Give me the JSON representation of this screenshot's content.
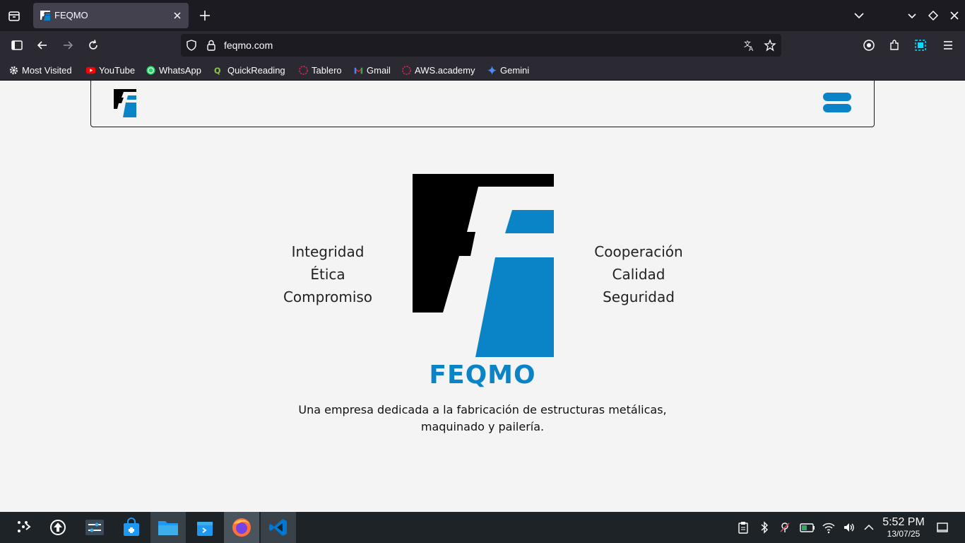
{
  "browser": {
    "tab": {
      "title": "FEQMO"
    },
    "url": "feqmo.com",
    "bookmarks": [
      {
        "label": "Most Visited",
        "icon": "gear-icon"
      },
      {
        "label": "YouTube",
        "icon": "youtube-icon"
      },
      {
        "label": "WhatsApp",
        "icon": "whatsapp-icon"
      },
      {
        "label": "QuickReading",
        "icon": "quickreading-icon"
      },
      {
        "label": "Tablero",
        "icon": "dashed-circle-icon"
      },
      {
        "label": "Gmail",
        "icon": "gmail-icon"
      },
      {
        "label": "AWS.academy",
        "icon": "dashed-circle-icon"
      },
      {
        "label": "Gemini",
        "icon": "gemini-icon"
      }
    ]
  },
  "site": {
    "values_left": [
      "Integridad",
      "Ética",
      "Compromiso"
    ],
    "values_right": [
      "Cooperación",
      "Calidad",
      "Seguridad"
    ],
    "brand": "FEQMO",
    "tagline_line1": "Una empresa dedicada a la fabricación de estructuras metálicas,",
    "tagline_line2": "maquinado y pailería.",
    "colors": {
      "brand_blue": "#0a84c6",
      "logo_black": "#000000"
    }
  },
  "taskbar": {
    "apps": [
      "application-launcher",
      "update-manager",
      "system-settings",
      "discover-store",
      "file-manager",
      "software-center",
      "firefox",
      "vscode"
    ],
    "clock_time": "5:52 PM",
    "clock_date": "13/07/25"
  }
}
